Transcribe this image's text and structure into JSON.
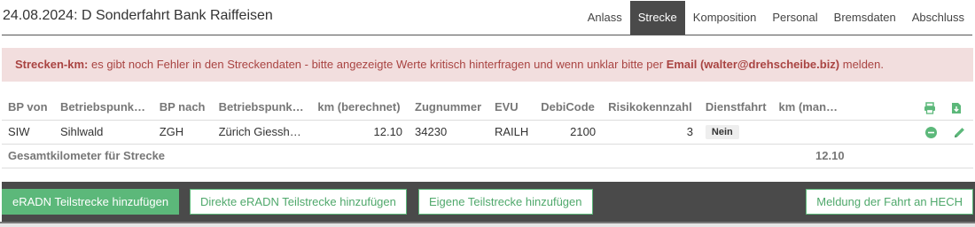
{
  "header": {
    "title": "24.08.2024: D Sonderfahrt Bank Raiffeisen",
    "tabs": [
      {
        "label": "Anlass"
      },
      {
        "label": "Strecke"
      },
      {
        "label": "Komposition"
      },
      {
        "label": "Personal"
      },
      {
        "label": "Bremsdaten"
      },
      {
        "label": "Abschluss"
      }
    ],
    "active_tab": "Strecke"
  },
  "alert": {
    "prefix": "Strecken-km:",
    "text": " es gibt noch Fehler in den Streckendaten - bitte angezeigte Werte kritisch hinterfragen und wenn unklar bitte per ",
    "email": "Email (walter@drehscheibe.biz)",
    "suffix": " melden.",
    "color": "#a94442",
    "background": "#f2dede"
  },
  "table": {
    "columns": [
      "BP von",
      "Betriebspunk…",
      "BP nach",
      "Betriebspunk…",
      "km (berechnet)",
      "Zugnummer",
      "EVU",
      "DebiCode",
      "Risikokennzahl",
      "Dienstfahrt",
      "km (man…"
    ],
    "header_icons": [
      "print-icon",
      "export-icon"
    ],
    "rows": [
      {
        "bp_von": "SIW",
        "bp_von_name": "Sihlwald",
        "bp_nach": "ZGH",
        "bp_nach_name": "Zürich Giessh…",
        "km_berechnet": "12.10",
        "zugnummer": "34230",
        "evu": "RAILH",
        "debicode": "2100",
        "risikokennzahl": "3",
        "dienstfahrt": "Nein",
        "km_manuell": "",
        "action_icons": [
          "remove-icon",
          "edit-icon"
        ]
      }
    ],
    "total": {
      "label": "Gesamtkilometer für Strecke",
      "value": "12.10"
    }
  },
  "footer": {
    "buttons": [
      {
        "label": "eRADN Teilstrecke hinzufügen"
      },
      {
        "label": "Direkte eRADN Teilstrecke hinzufügen"
      },
      {
        "label": "Eigene Teilstrecke hinzufügen"
      },
      {
        "label": "Meldung der Fahrt an HECH"
      }
    ]
  },
  "colors": {
    "accent_green": "#5cb87a",
    "dark_bar": "#4a4a4a"
  }
}
